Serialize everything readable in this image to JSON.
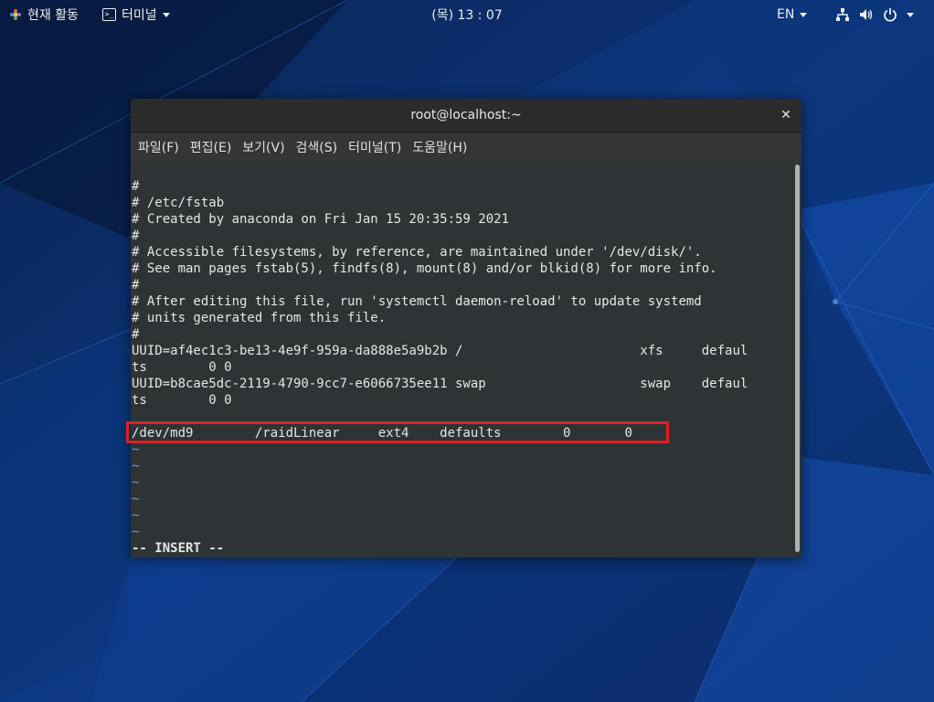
{
  "topbar": {
    "activities": "현재 활동",
    "app_menu": "터미널",
    "clock": "(목) 13 : 07",
    "language": "EN",
    "icons": [
      "network-icon",
      "volume-icon",
      "power-icon"
    ]
  },
  "window": {
    "title": "root@localhost:~",
    "close_glyph": "✕",
    "menu": [
      "파일(F)",
      "편집(E)",
      "보기(V)",
      "검색(S)",
      "터미널(T)",
      "도움말(H)"
    ]
  },
  "terminal": {
    "lines": [
      "#",
      "# /etc/fstab",
      "# Created by anaconda on Fri Jan 15 20:35:59 2021",
      "#",
      "# Accessible filesystems, by reference, are maintained under '/dev/disk/'.",
      "# See man pages fstab(5), findfs(8), mount(8) and/or blkid(8) for more info.",
      "#",
      "# After editing this file, run 'systemctl daemon-reload' to update systemd",
      "# units generated from this file.",
      "#",
      "UUID=af4ec1c3-be13-4e9f-959a-da888e5a9b2b /                       xfs     defaul",
      "ts        0 0",
      "UUID=b8cae5dc-2119-4790-9cc7-e6066735ee11 swap                    swap    defaul",
      "ts        0 0",
      "",
      "/dev/md9        /raidLinear     ext4    defaults        0       0",
      "~",
      "~",
      "~",
      "~",
      "~",
      "~",
      "-- INSERT --"
    ],
    "tilde_lines": [
      16,
      17,
      18,
      19,
      20,
      21
    ],
    "mode_line": 22,
    "highlighted_line": 15
  },
  "colors": {
    "terminal_bg": "#2e3436",
    "terminal_fg": "#e6e6e6",
    "tilde": "#729fcf",
    "highlight_box": "#e01f26",
    "desktop_bg": "#0b2a5e"
  }
}
